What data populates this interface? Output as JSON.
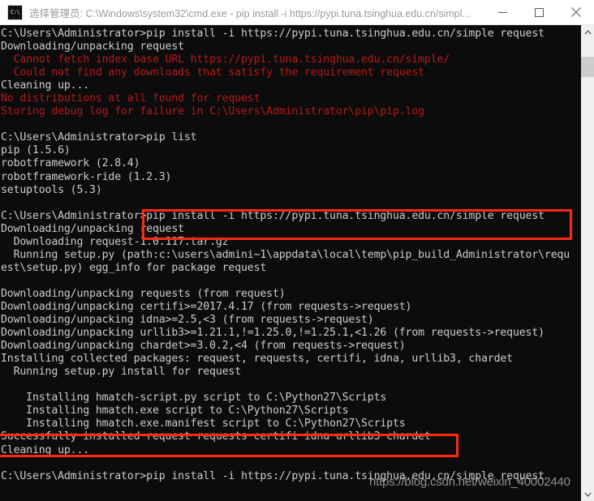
{
  "window": {
    "title": "选择管理员: C:\\Windows\\system32\\cmd.exe - pip  install -i https://pypi.tuna.tsinghua.edu.cn/simpl...",
    "icon_label": "C:\\",
    "controls": {
      "minimize": "minimize-button",
      "maximize": "maximize-button",
      "close": "close-button"
    }
  },
  "colors": {
    "console_background": "#0c0c0c",
    "console_text": "#cccccc",
    "console_error_text": "#b51919",
    "annotation_red": "#fb2b13",
    "titlebar_background": "#ffffff",
    "titlebar_text": "#9b9b9b",
    "scrollbar_track": "#f0f0f0",
    "scrollbar_thumb": "#cdcdcd"
  },
  "scrollbar": {
    "up_arrow": "scroll-up-arrow",
    "down_arrow": "scroll-down-arrow"
  },
  "watermark": {
    "text": "https://blog.csdn.net/weixin_40002440"
  },
  "annotations": [
    {
      "name": "annotation-box-command",
      "target_text": "C:\\Users\\Administrator>pip install -i https://pypi.tuna.tsinghua.edu.cn/simple request"
    },
    {
      "name": "annotation-box-success",
      "target_text": "Successfully installed request requests certifi idna urllib3 chardet"
    }
  ],
  "console": {
    "lines": [
      {
        "text": "C:\\Users\\Administrator>pip install -i https://pypi.tuna.tsinghua.edu.cn/simple request",
        "color": "normal"
      },
      {
        "text": "Downloading/unpacking request",
        "color": "normal"
      },
      {
        "text": "  Cannot fetch index base URL https://pypi.tuna.tsinghua.edu.cn/simple/",
        "color": "red"
      },
      {
        "text": "  Could not find any downloads that satisfy the requirement request",
        "color": "red"
      },
      {
        "text": "Cleaning up...",
        "color": "normal"
      },
      {
        "text": "No distributions at all found for request",
        "color": "red"
      },
      {
        "text": "Storing debug log for failure in C:\\Users\\Administrator\\pip\\pip.log",
        "color": "red"
      },
      {
        "text": "",
        "color": "blank"
      },
      {
        "text": "C:\\Users\\Administrator>pip list",
        "color": "normal"
      },
      {
        "text": "pip (1.5.6)",
        "color": "normal"
      },
      {
        "text": "robotframework (2.8.4)",
        "color": "normal"
      },
      {
        "text": "robotframework-ride (1.2.3)",
        "color": "normal"
      },
      {
        "text": "setuptools (5.3)",
        "color": "normal"
      },
      {
        "text": "",
        "color": "blank"
      },
      {
        "text": "C:\\Users\\Administrator>pip install -i https://pypi.tuna.tsinghua.edu.cn/simple request",
        "color": "normal"
      },
      {
        "text": "Downloading/unpacking request",
        "color": "normal"
      },
      {
        "text": "  Downloading request-1.0.117.tar.gz",
        "color": "normal"
      },
      {
        "text": "  Running setup.py (path:c:\\users\\admini~1\\appdata\\local\\temp\\pip_build_Administrator\\requ",
        "color": "normal"
      },
      {
        "text": "est\\setup.py) egg_info for package request",
        "color": "normal"
      },
      {
        "text": "",
        "color": "blank"
      },
      {
        "text": "Downloading/unpacking requests (from request)",
        "color": "normal"
      },
      {
        "text": "Downloading/unpacking certifi>=2017.4.17 (from requests->request)",
        "color": "normal"
      },
      {
        "text": "Downloading/unpacking idna>=2.5,<3 (from requests->request)",
        "color": "normal"
      },
      {
        "text": "Downloading/unpacking urllib3>=1.21.1,!=1.25.0,!=1.25.1,<1.26 (from requests->request)",
        "color": "normal"
      },
      {
        "text": "Downloading/unpacking chardet>=3.0.2,<4 (from requests->request)",
        "color": "normal"
      },
      {
        "text": "Installing collected packages: request, requests, certifi, idna, urllib3, chardet",
        "color": "normal"
      },
      {
        "text": "  Running setup.py install for request",
        "color": "normal"
      },
      {
        "text": "",
        "color": "blank"
      },
      {
        "text": "    Installing hmatch-script.py script to C:\\Python27\\Scripts",
        "color": "normal"
      },
      {
        "text": "    Installing hmatch.exe script to C:\\Python27\\Scripts",
        "color": "normal"
      },
      {
        "text": "    Installing hmatch.exe.manifest script to C:\\Python27\\Scripts",
        "color": "normal"
      },
      {
        "text": "Successfully installed request requests certifi idna urllib3 chardet",
        "color": "normal"
      },
      {
        "text": "Cleaning up...",
        "color": "normal"
      },
      {
        "text": "",
        "color": "blank"
      },
      {
        "text": "C:\\Users\\Administrator>pip install -i https://pypi.tuna.tsinghua.edu.cn/simple request",
        "color": "normal"
      }
    ]
  }
}
